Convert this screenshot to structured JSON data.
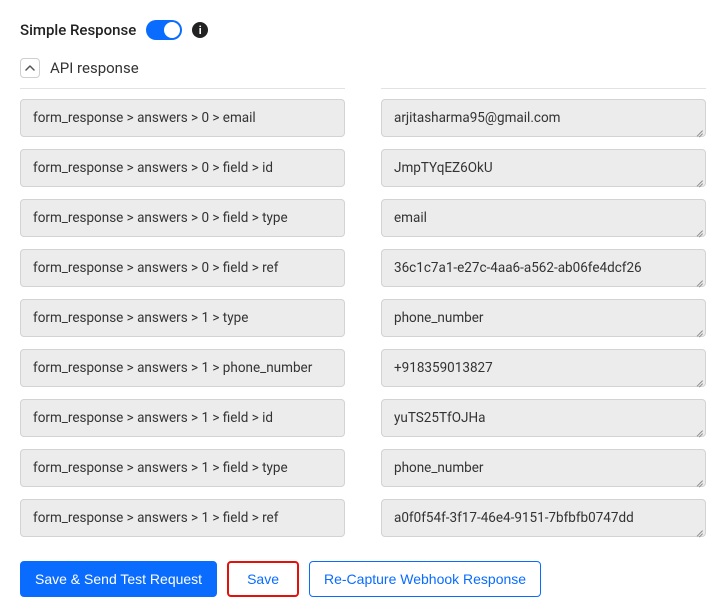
{
  "header": {
    "simple_response_label": "Simple Response"
  },
  "section": {
    "title": "API response"
  },
  "fields": [
    {
      "key": "form_response > answers > 0 > email",
      "value": "arjitasharma95@gmail.com"
    },
    {
      "key": "form_response > answers > 0 > field > id",
      "value": "JmpTYqEZ6OkU"
    },
    {
      "key": "form_response > answers > 0 > field > type",
      "value": "email"
    },
    {
      "key": "form_response > answers > 0 > field > ref",
      "value": "36c1c7a1-e27c-4aa6-a562-ab06fe4dcf26"
    },
    {
      "key": "form_response > answers > 1 > type",
      "value": "phone_number"
    },
    {
      "key": "form_response > answers > 1 > phone_number",
      "value": "+918359013827"
    },
    {
      "key": "form_response > answers > 1 > field > id",
      "value": "yuTS25TfOJHa"
    },
    {
      "key": "form_response > answers > 1 > field > type",
      "value": "phone_number"
    },
    {
      "key": "form_response > answers > 1 > field > ref",
      "value": "a0f0f54f-3f17-46e4-9151-7bfbfb0747dd"
    }
  ],
  "buttons": {
    "save_send": "Save & Send Test Request",
    "save": "Save",
    "recapture": "Re-Capture Webhook Response"
  }
}
